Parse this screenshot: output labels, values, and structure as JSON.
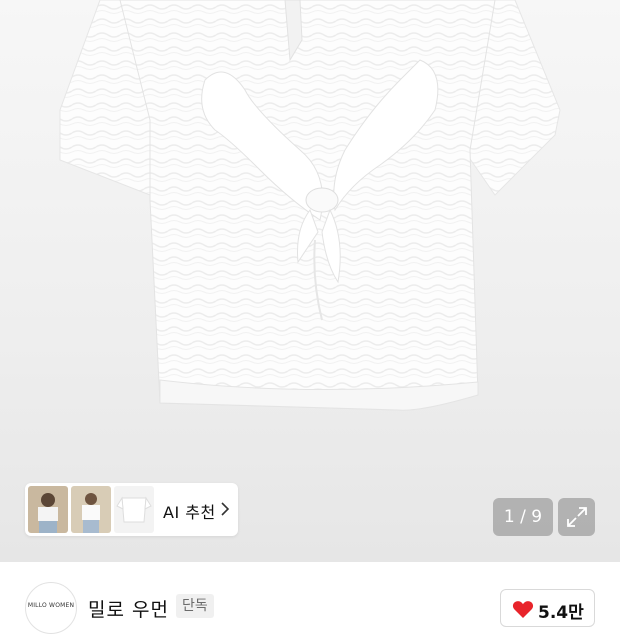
{
  "gallery": {
    "counter": "1 / 9",
    "ai_recommend_label": "AI 추천",
    "thumbnails": [
      "thumbnail-1",
      "thumbnail-2",
      "thumbnail-3"
    ]
  },
  "brand": {
    "logo_text": "MILLO WOMEN",
    "name": "밀로 우먼",
    "badge": "단독"
  },
  "like": {
    "count": "5.4만",
    "icon": "heart-icon",
    "color": "#e8242b"
  }
}
